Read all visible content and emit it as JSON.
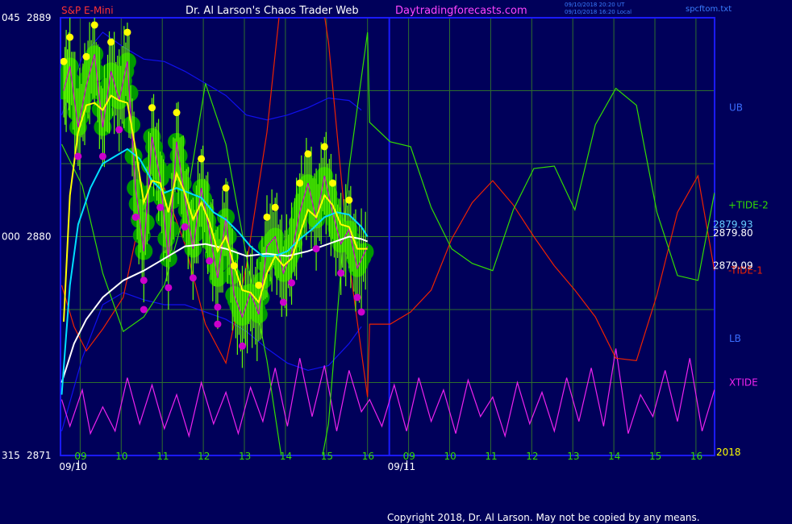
{
  "header": {
    "symbol": "S&P E-Mini",
    "author": "Dr. Al Larson's Chaos Trader Web",
    "site": "Daytradingforecasts.com",
    "stamp_ut": "09/10/2018 20:20 UT",
    "stamp_local": "09/10/2018 16:20 Local",
    "file": "spcftom.txt"
  },
  "footer": {
    "copyright": "Copyright 2018, Dr. Al Larson. May not be copied by any means."
  },
  "colors": {
    "background": "#00005a",
    "frame": "#1a1aff",
    "grid": "#2e6e2e",
    "text": "#ffffff",
    "price": "#66ff00",
    "bubble": "#009900",
    "high_dot": "#ffff00",
    "low_dot": "#cc00cc",
    "fast_avg": "#ffff00",
    "mid_avg": "#00e0ff",
    "slow_avg": "#ffffff",
    "band": "#1010ee",
    "tide2": "#33dd00",
    "tide1": "#ee2200",
    "xtide": "#ee22ee",
    "symbol": "#ff3333",
    "site": "#ff44ff"
  },
  "chart_data": {
    "type": "line",
    "ylim": [
      2871,
      2889
    ],
    "y_ticks": [
      {
        "value": 2889,
        "left": "045",
        "right": "2889"
      },
      {
        "value": 2880,
        "left": "000",
        "right": "2880"
      },
      {
        "value": 2871,
        "left": "315",
        "right": "2871"
      }
    ],
    "x_hour_ticks": [
      {
        "t": 0.45,
        "label": "09"
      },
      {
        "t": 1.45,
        "label": "10"
      },
      {
        "t": 2.45,
        "label": "11"
      },
      {
        "t": 3.45,
        "label": "12"
      },
      {
        "t": 4.45,
        "label": "13"
      },
      {
        "t": 5.45,
        "label": "14"
      },
      {
        "t": 6.45,
        "label": "15"
      },
      {
        "t": 7.45,
        "label": "16"
      },
      {
        "t": 8.45,
        "label": "09"
      },
      {
        "t": 9.45,
        "label": "10"
      },
      {
        "t": 10.45,
        "label": "11"
      },
      {
        "t": 11.45,
        "label": "12"
      },
      {
        "t": 12.45,
        "label": "13"
      },
      {
        "t": 13.45,
        "label": "14"
      },
      {
        "t": 14.45,
        "label": "15"
      },
      {
        "t": 15.45,
        "label": "16"
      }
    ],
    "date_labels": [
      {
        "t": 0.45,
        "label": "09/10"
      },
      {
        "t": 8.45,
        "label": "09/11"
      }
    ],
    "year_label": "2018",
    "last_values": [
      "2879.93",
      "2879.80",
      "2879.09"
    ],
    "legend": [
      {
        "label": "UB",
        "value": 2885.3
      },
      {
        "label": "+TIDE-2",
        "value": 2881.3
      },
      {
        "label": "-TIDE-1",
        "value": 2878.6
      },
      {
        "label": "LB",
        "value": 2875.8
      },
      {
        "label": "XTIDE",
        "value": 2874.0
      }
    ],
    "series": [
      {
        "name": "price",
        "x": [
          0.05,
          0.2,
          0.4,
          0.6,
          0.8,
          1.0,
          1.2,
          1.4,
          1.6,
          1.8,
          2.0,
          2.2,
          2.4,
          2.6,
          2.8,
          3.0,
          3.2,
          3.4,
          3.6,
          3.8,
          4.0,
          4.2,
          4.4,
          4.6,
          4.8,
          5.0,
          5.2,
          5.4,
          5.6,
          5.8,
          6.0,
          6.2,
          6.4,
          6.6,
          6.8,
          7.0,
          7.2,
          7.45
        ],
        "y": [
          2886.0,
          2887.0,
          2884.5,
          2886.2,
          2887.5,
          2884.5,
          2886.8,
          2885.6,
          2887.2,
          2882.0,
          2879.4,
          2884.1,
          2882.4,
          2879.1,
          2883.9,
          2881.6,
          2879.5,
          2882.0,
          2880.2,
          2878.3,
          2880.8,
          2877.6,
          2876.7,
          2877.7,
          2876.8,
          2879.6,
          2880.0,
          2878.5,
          2879.3,
          2881.0,
          2882.2,
          2880.7,
          2882.5,
          2881.0,
          2879.7,
          2880.3,
          2878.7,
          2879.6
        ]
      },
      {
        "name": "yellow avg",
        "x": [
          0.05,
          0.2,
          0.4,
          0.6,
          0.8,
          1.0,
          1.2,
          1.4,
          1.6,
          1.8,
          2.0,
          2.2,
          2.4,
          2.6,
          2.8,
          3.0,
          3.2,
          3.4,
          3.6,
          3.8,
          4.0,
          4.2,
          4.4,
          4.6,
          4.8,
          5.0,
          5.2,
          5.4,
          5.6,
          5.8,
          6.0,
          6.2,
          6.4,
          6.6,
          6.8,
          7.0,
          7.2,
          7.45
        ],
        "y": [
          2876.5,
          2881.7,
          2884.3,
          2885.4,
          2885.5,
          2885.2,
          2885.8,
          2885.6,
          2885.5,
          2883.6,
          2881.4,
          2882.3,
          2882.2,
          2881.0,
          2882.6,
          2881.8,
          2880.7,
          2881.4,
          2880.6,
          2879.4,
          2880.0,
          2878.8,
          2877.8,
          2877.7,
          2877.3,
          2878.5,
          2879.2,
          2878.8,
          2879.1,
          2880.1,
          2881.1,
          2880.8,
          2881.7,
          2881.3,
          2880.5,
          2880.4,
          2879.5,
          2879.5
        ]
      },
      {
        "name": "cyan avg",
        "x": [
          0.0,
          0.2,
          0.4,
          0.7,
          1.0,
          1.3,
          1.6,
          1.9,
          2.2,
          2.5,
          2.8,
          3.1,
          3.4,
          3.7,
          4.0,
          4.3,
          4.6,
          4.9,
          5.2,
          5.5,
          5.8,
          6.1,
          6.4,
          6.7,
          7.0,
          7.3,
          7.45
        ],
        "y": [
          2873.5,
          2878.0,
          2880.5,
          2882.0,
          2883.0,
          2883.3,
          2883.6,
          2883.2,
          2882.3,
          2881.8,
          2882.0,
          2881.8,
          2881.6,
          2881.0,
          2880.7,
          2880.2,
          2879.6,
          2879.2,
          2879.2,
          2879.4,
          2879.9,
          2880.3,
          2880.8,
          2881.0,
          2880.9,
          2880.4,
          2880.0
        ]
      },
      {
        "name": "white avg",
        "x": [
          0.0,
          0.3,
          0.6,
          1.0,
          1.5,
          2.0,
          2.5,
          3.0,
          3.5,
          4.0,
          4.5,
          5.0,
          5.5,
          6.0,
          6.5,
          7.0,
          7.3,
          7.45
        ],
        "y": [
          2874.0,
          2875.6,
          2876.6,
          2877.5,
          2878.2,
          2878.6,
          2879.1,
          2879.6,
          2879.7,
          2879.5,
          2879.2,
          2879.3,
          2879.2,
          2879.4,
          2879.7,
          2880.0,
          2879.9,
          2879.8
        ]
      },
      {
        "name": "UB",
        "x": [
          0.0,
          0.5,
          1.0,
          1.5,
          2.0,
          2.5,
          3.0,
          3.5,
          4.0,
          4.5,
          5.0,
          5.5,
          6.0,
          6.5,
          7.0,
          7.3
        ],
        "y": [
          2885.0,
          2887.4,
          2888.4,
          2887.8,
          2887.3,
          2887.2,
          2886.8,
          2886.3,
          2885.8,
          2885.0,
          2884.8,
          2885.0,
          2885.3,
          2885.7,
          2885.6,
          2885.2
        ]
      },
      {
        "name": "LB",
        "x": [
          0.0,
          0.5,
          1.0,
          1.5,
          2.0,
          2.5,
          3.0,
          3.5,
          4.0,
          4.5,
          5.0,
          5.5,
          6.0,
          6.5,
          7.0,
          7.3
        ],
        "y": [
          2872.0,
          2875.0,
          2877.2,
          2877.7,
          2877.4,
          2877.2,
          2877.2,
          2876.9,
          2876.6,
          2876.1,
          2875.4,
          2874.8,
          2874.5,
          2874.7,
          2875.6,
          2876.3
        ]
      },
      {
        "name": "+TIDE-2",
        "x": [
          0.0,
          0.5,
          1.0,
          1.5,
          2.0,
          2.5,
          3.0,
          3.5,
          4.0,
          4.5,
          5.0,
          5.5,
          6.0,
          6.5,
          7.0,
          7.45,
          7.5,
          8.0,
          8.5,
          9.0,
          9.5,
          10.0,
          10.5,
          11.0,
          11.5,
          12.0,
          12.5,
          13.0,
          13.5,
          14.0,
          14.5,
          15.0,
          15.5,
          15.9
        ],
        "y": [
          2883.8,
          2882.1,
          2878.5,
          2876.1,
          2876.7,
          2878.0,
          2881.0,
          2886.3,
          2883.8,
          2879.2,
          2874.9,
          2869.3,
          2867.8,
          2872.3,
          2882.8,
          2888.4,
          2884.7,
          2883.9,
          2883.7,
          2881.2,
          2879.5,
          2878.9,
          2878.6,
          2881.1,
          2882.8,
          2882.9,
          2881.1,
          2884.6,
          2886.1,
          2885.4,
          2881.0,
          2878.4,
          2878.2,
          2881.8
        ]
      },
      {
        "name": "-TIDE-1",
        "x": [
          0.0,
          0.3,
          0.6,
          1.0,
          1.5,
          2.0,
          2.5,
          3.0,
          3.5,
          4.0,
          4.5,
          5.0,
          5.5,
          6.0,
          6.5,
          7.0,
          7.45,
          7.5,
          8.0,
          8.5,
          9.0,
          9.5,
          10.0,
          10.5,
          11.0,
          11.5,
          12.0,
          12.5,
          13.0,
          13.5,
          14.0,
          14.5,
          15.0,
          15.5,
          15.9
        ],
        "y": [
          2878.0,
          2876.3,
          2875.3,
          2876.2,
          2877.5,
          2881.5,
          2882.0,
          2879.7,
          2876.4,
          2874.8,
          2878.8,
          2884.3,
          2892.3,
          2893.6,
          2888.0,
          2879.0,
          2873.4,
          2876.4,
          2876.4,
          2876.9,
          2877.8,
          2879.9,
          2881.4,
          2882.3,
          2881.3,
          2880.0,
          2878.8,
          2877.8,
          2876.7,
          2875.0,
          2874.9,
          2877.6,
          2881.0,
          2882.5,
          2878.6
        ]
      },
      {
        "name": "XTIDE",
        "x": [
          0.0,
          0.2,
          0.5,
          0.7,
          1.0,
          1.3,
          1.6,
          1.9,
          2.2,
          2.5,
          2.8,
          3.1,
          3.4,
          3.7,
          4.0,
          4.3,
          4.6,
          4.9,
          5.2,
          5.5,
          5.8,
          6.1,
          6.4,
          6.7,
          7.0,
          7.3,
          7.5,
          7.8,
          8.1,
          8.4,
          8.7,
          9.0,
          9.3,
          9.6,
          9.9,
          10.2,
          10.5,
          10.8,
          11.1,
          11.4,
          11.7,
          12.0,
          12.3,
          12.6,
          12.9,
          13.2,
          13.5,
          13.8,
          14.1,
          14.4,
          14.7,
          15.0,
          15.3,
          15.6,
          15.9
        ],
        "y": [
          2873.3,
          2872.2,
          2873.7,
          2871.9,
          2873.0,
          2872.0,
          2874.2,
          2872.3,
          2873.9,
          2872.1,
          2873.5,
          2871.8,
          2874.0,
          2872.3,
          2873.6,
          2871.9,
          2873.8,
          2872.4,
          2874.6,
          2872.2,
          2875.0,
          2872.6,
          2874.7,
          2872.0,
          2874.5,
          2872.8,
          2873.3,
          2872.2,
          2873.9,
          2872.0,
          2874.2,
          2872.4,
          2873.7,
          2871.9,
          2874.1,
          2872.6,
          2873.4,
          2871.8,
          2874.0,
          2872.3,
          2873.6,
          2872.0,
          2874.2,
          2872.4,
          2874.6,
          2872.2,
          2875.4,
          2871.9,
          2873.5,
          2872.6,
          2874.5,
          2872.4,
          2875.0,
          2872.0,
          2873.7
        ]
      }
    ],
    "high_points": [
      {
        "x": 0.05,
        "y": 2886.0
      },
      {
        "x": 0.2,
        "y": 2887.0
      },
      {
        "x": 0.6,
        "y": 2886.2
      },
      {
        "x": 0.8,
        "y": 2887.5
      },
      {
        "x": 1.2,
        "y": 2886.8
      },
      {
        "x": 1.6,
        "y": 2887.2
      },
      {
        "x": 1.6,
        "y": 2888.4
      },
      {
        "x": 2.2,
        "y": 2884.1
      },
      {
        "x": 2.8,
        "y": 2883.9
      },
      {
        "x": 3.4,
        "y": 2882.0
      },
      {
        "x": 4.0,
        "y": 2880.8
      },
      {
        "x": 5.0,
        "y": 2879.6
      },
      {
        "x": 5.2,
        "y": 2880.0
      },
      {
        "x": 5.8,
        "y": 2881.0
      },
      {
        "x": 6.0,
        "y": 2882.2
      },
      {
        "x": 6.4,
        "y": 2882.5
      },
      {
        "x": 6.6,
        "y": 2881.0
      },
      {
        "x": 7.0,
        "y": 2880.3
      },
      {
        "x": 4.8,
        "y": 2876.8
      },
      {
        "x": 4.2,
        "y": 2877.6
      }
    ],
    "low_points": [
      {
        "x": 0.4,
        "y": 2884.5
      },
      {
        "x": 1.0,
        "y": 2884.5
      },
      {
        "x": 1.4,
        "y": 2885.6
      },
      {
        "x": 1.8,
        "y": 2882.0
      },
      {
        "x": 2.0,
        "y": 2879.4
      },
      {
        "x": 2.4,
        "y": 2882.4
      },
      {
        "x": 2.6,
        "y": 2879.1
      },
      {
        "x": 3.0,
        "y": 2881.6
      },
      {
        "x": 3.2,
        "y": 2879.5
      },
      {
        "x": 3.6,
        "y": 2880.2
      },
      {
        "x": 3.8,
        "y": 2878.3
      },
      {
        "x": 4.4,
        "y": 2876.7
      },
      {
        "x": 5.4,
        "y": 2878.5
      },
      {
        "x": 5.6,
        "y": 2879.3
      },
      {
        "x": 6.2,
        "y": 2880.7
      },
      {
        "x": 6.8,
        "y": 2879.7
      },
      {
        "x": 7.2,
        "y": 2878.7
      },
      {
        "x": 2.0,
        "y": 2878.2
      },
      {
        "x": 3.8,
        "y": 2877.6
      },
      {
        "x": 7.3,
        "y": 2878.1
      }
    ]
  }
}
